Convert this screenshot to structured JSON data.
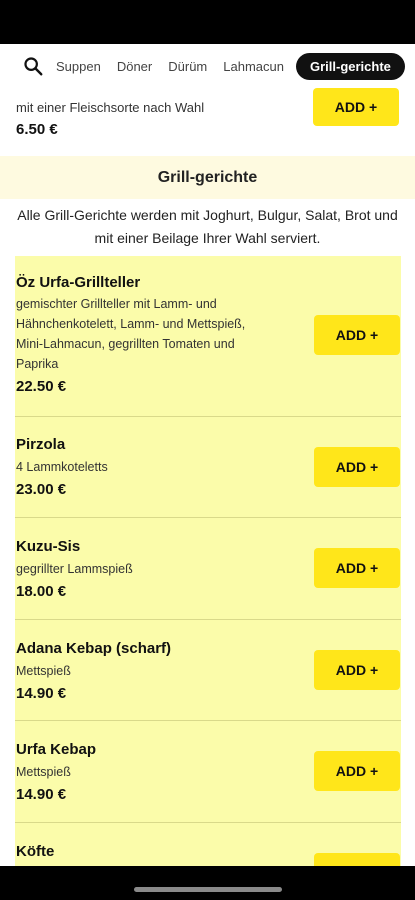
{
  "tabs": [
    "Suppen",
    "Döner",
    "Dürüm",
    "Lahmacun",
    "Grill-gerichte"
  ],
  "active_tab": "Grill-gerichte",
  "top_item": {
    "description": "mit einer Fleischsorte nach Wahl",
    "price": "6.50 €",
    "add_label": "ADD +"
  },
  "section": {
    "title": "Grill-gerichte",
    "note": "Alle Grill-Gerichte werden mit Joghurt, Bulgur, Salat, Brot und mit einer Beilage Ihrer Wahl serviert."
  },
  "items": [
    {
      "name": "Öz Urfa-Grillteller",
      "description": "gemischter Grillteller mit Lamm- und Hähnchenkotelett, Lamm- und Mettspieß, Mini-Lahmacun, gegrillten Tomaten und Paprika",
      "price": "22.50 €",
      "add_label": "ADD +"
    },
    {
      "name": "Pirzola",
      "description": "4 Lammkoteletts",
      "price": "23.00 €",
      "add_label": "ADD +"
    },
    {
      "name": "Kuzu-Sis",
      "description": "gegrillter Lammspieß",
      "price": "18.00 €",
      "add_label": "ADD +"
    },
    {
      "name": "Adana Kebap (scharf)",
      "description": "Mettspieß",
      "price": "14.90 €",
      "add_label": "ADD +"
    },
    {
      "name": "Urfa Kebap",
      "description": "Mettspieß",
      "price": "14.90 €",
      "add_label": "ADD +"
    },
    {
      "name": "Köfte",
      "description": "",
      "price": "",
      "add_label": "ADD +"
    }
  ],
  "colors": {
    "accent_button": "#ffe61a",
    "list_background": "#fbfcaa",
    "section_header_background": "#fefae0",
    "active_tab_background": "#111111"
  },
  "icons": {
    "search": "search-icon"
  }
}
